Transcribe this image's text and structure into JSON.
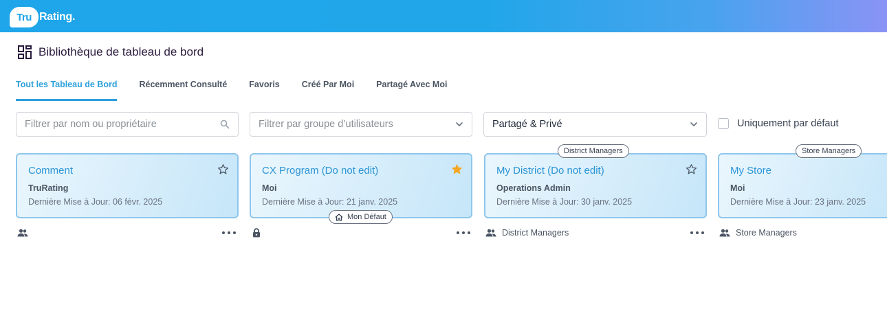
{
  "brand": {
    "logo_badge": "Tru",
    "logo_rest": "Rating."
  },
  "page": {
    "title": "Bibliothèque de tableau de bord",
    "icon": "dashboard-grid-icon"
  },
  "tabs": [
    {
      "label": "Tout les Tableau de Bord",
      "active": true
    },
    {
      "label": "Récemment Consulté",
      "active": false
    },
    {
      "label": "Favoris",
      "active": false
    },
    {
      "label": "Créé Par Moi",
      "active": false
    },
    {
      "label": "Partagé Avec Moi",
      "active": false
    }
  ],
  "filters": {
    "search_placeholder": "Filtrer par nom ou propriétaire",
    "group_placeholder": "Filtrer par groupe d’utilisateurs",
    "sharing_value": "Partagé & Privé",
    "default_only_label": "Uniquement par défaut",
    "default_only_checked": false
  },
  "cards": [
    {
      "title": "Comment",
      "owner": "TruRating",
      "updated": "Dernière Mise à Jour: 06 févr. 2025",
      "favorite": false,
      "top_badge": "",
      "bottom_badge": "",
      "share_icon": "group-icon",
      "share_label": ""
    },
    {
      "title": "CX Program (Do not edit)",
      "owner": "Moi",
      "updated": "Dernière Mise à Jour: 21 janv. 2025",
      "favorite": true,
      "top_badge": "",
      "bottom_badge": "Mon Défaut",
      "share_icon": "lock-icon",
      "share_label": ""
    },
    {
      "title": "My District (Do not edit)",
      "owner": "Operations Admin",
      "updated": "Dernière Mise à Jour: 30 janv. 2025",
      "favorite": false,
      "top_badge": "District Managers",
      "bottom_badge": "",
      "share_icon": "group-icon",
      "share_label": "District Managers"
    },
    {
      "title": "My Store",
      "owner": "Moi",
      "updated": "Dernière Mise à Jour: 23 janv. 2025",
      "favorite": false,
      "top_badge": "Store Managers",
      "bottom_badge": "",
      "share_icon": "group-icon",
      "share_label": "Store Managers"
    }
  ],
  "colors": {
    "accent": "#2b9fdc",
    "star_active": "#f5a623",
    "card_border": "#8ec6ec",
    "header_start": "#1ea5ea",
    "header_end": "#8a93f5"
  }
}
